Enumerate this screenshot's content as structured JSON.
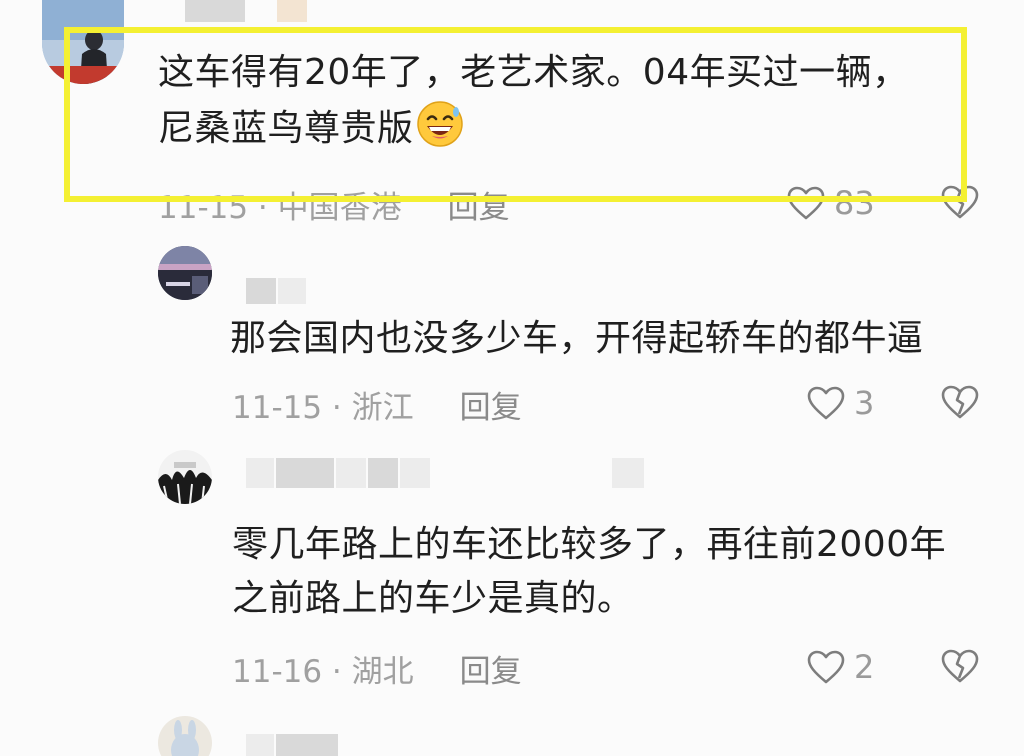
{
  "comments": [
    {
      "content_lines": [
        "这车得有20年了，老艺术家。04年买过一辆，",
        "尼桑蓝鸟尊贵版"
      ],
      "emoji": "grinning-face-with-sweat-emoji",
      "date_location": "11-15 · 中国香港",
      "reply_label": "回复",
      "likes": "83"
    },
    {
      "content_lines": [
        "那会国内也没多少车，开得起轿车的都牛逼"
      ],
      "date_location": "11-15 · 浙江",
      "reply_label": "回复",
      "likes": "3"
    },
    {
      "content_lines": [
        "零几年路上的车还比较多了，再往前2000年",
        "之前路上的车少是真的。"
      ],
      "date_location": "11-16 · 湖北",
      "reply_label": "回复",
      "likes": "2"
    }
  ],
  "colors": {
    "highlight_border": "#f4f033",
    "text": "#1f1f1f",
    "meta_text": "#a0a0a0"
  },
  "icons": [
    "heart-outline-icon",
    "broken-heart-icon"
  ]
}
